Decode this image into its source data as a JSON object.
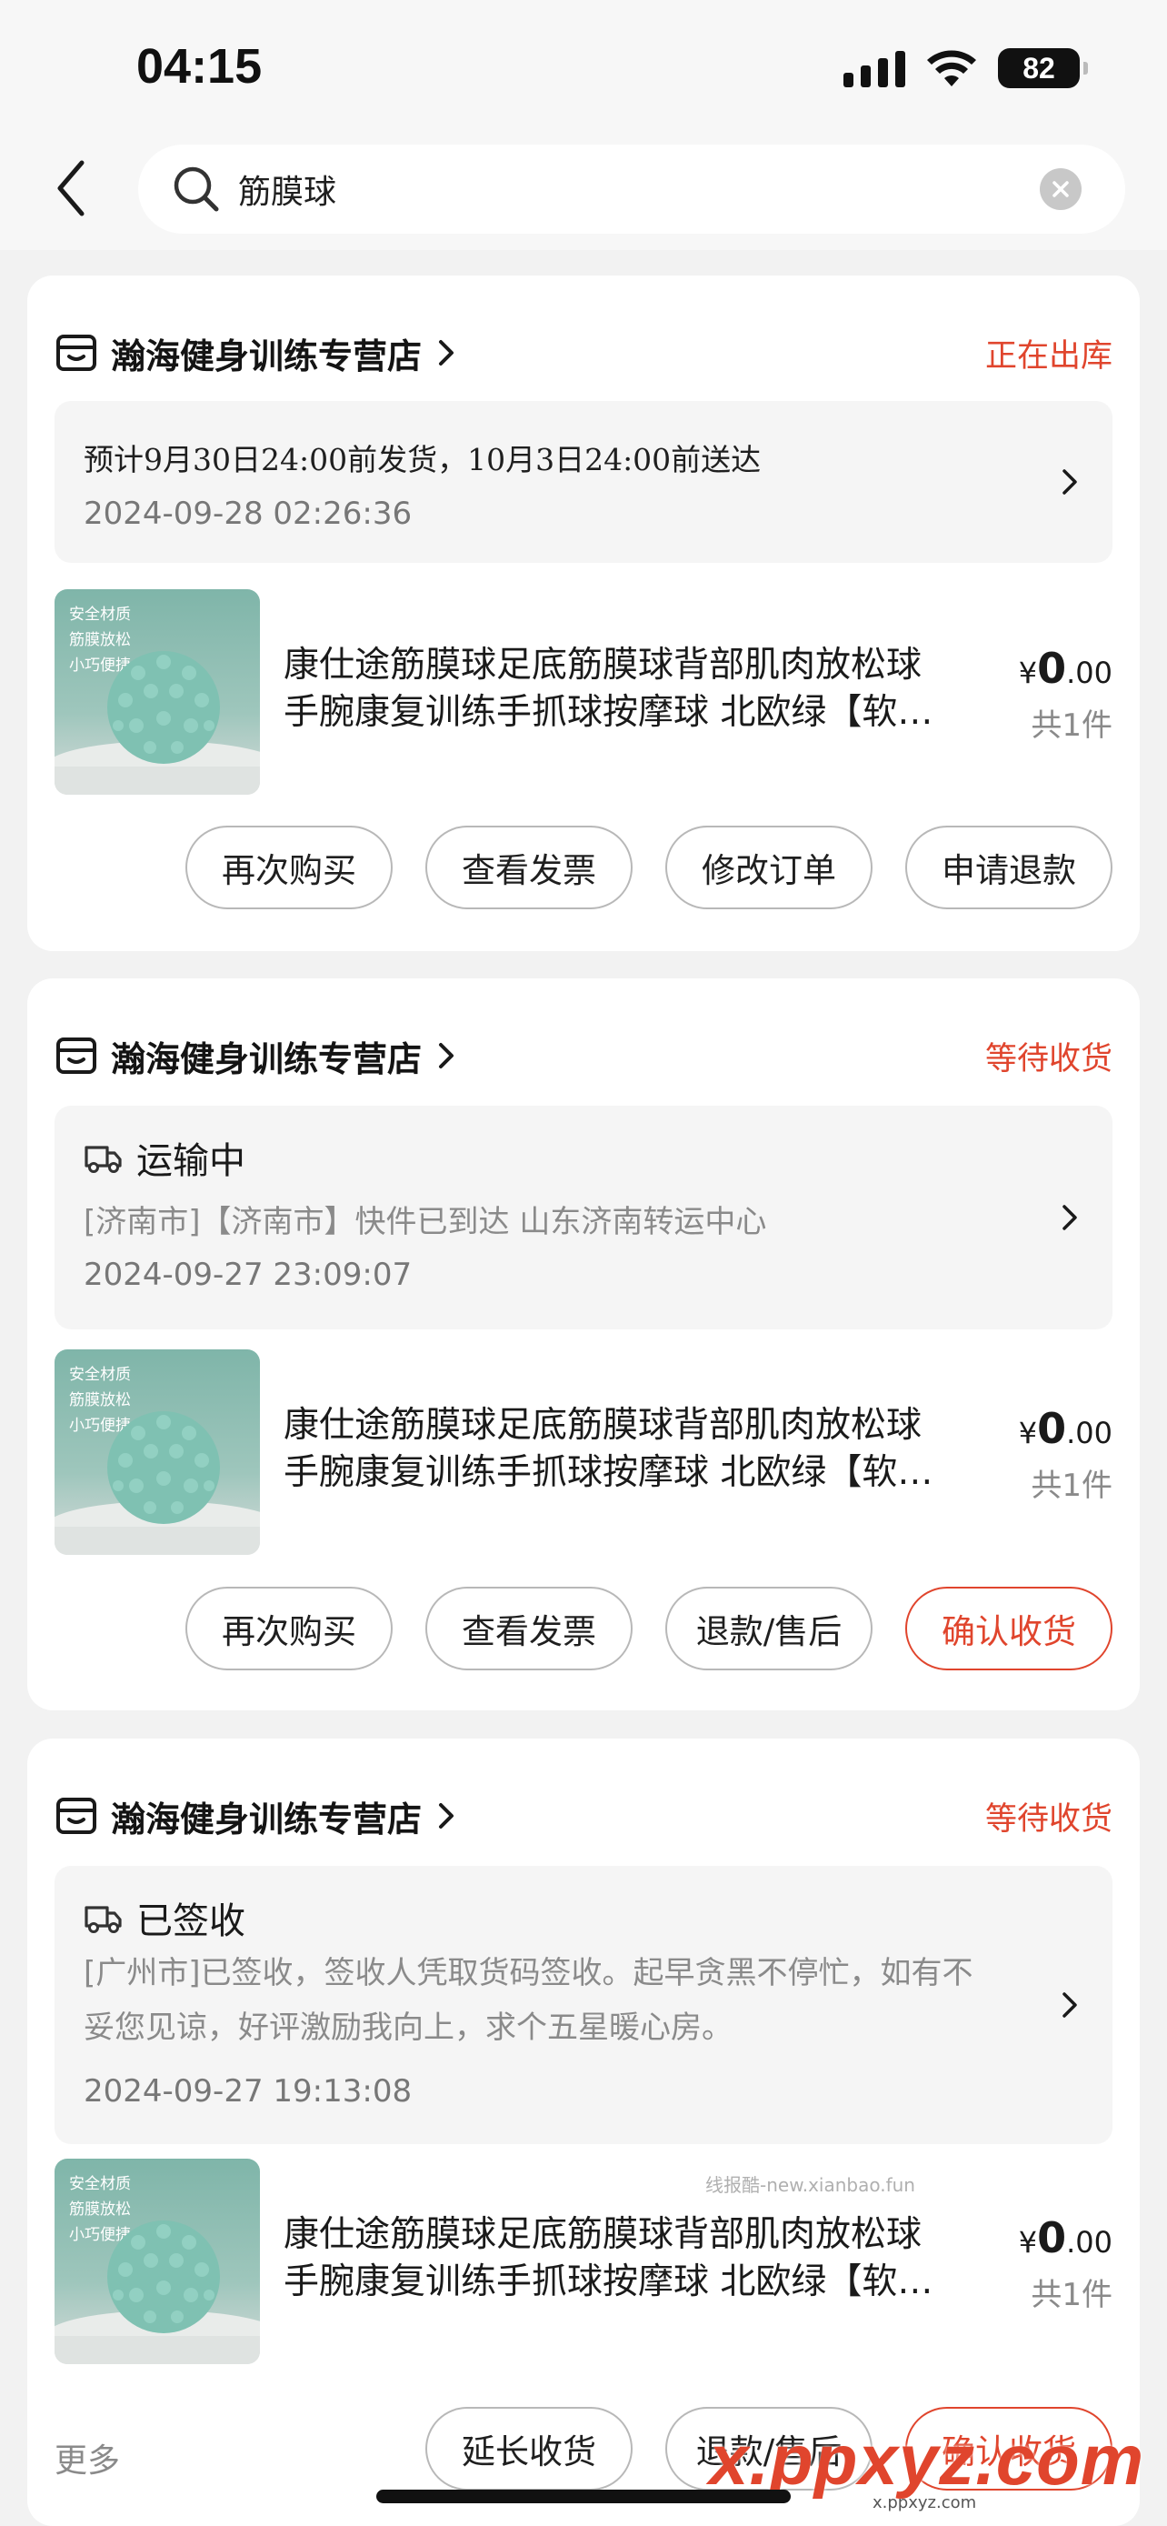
{
  "status_bar": {
    "time": "04:15",
    "battery": "82"
  },
  "search": {
    "query": "筋膜球"
  },
  "orders": [
    {
      "shop_name": "瀚海健身训练专营店",
      "status": "正在出库",
      "ship_plan": "预计9月30日24:00前发货，10月3日24:00前送达",
      "info_time": "2024-09-28 02:26:36",
      "product": {
        "image_tags": [
          "安全材质",
          "筋膜放松",
          "小巧便捷"
        ],
        "title_line1": "康仕途筋膜球足底筋膜球背部肌肉放松球",
        "title_line2": "手腕康复训练手抓球按摩球 北欧绿【软…",
        "price_symbol": "¥",
        "price_int": "0",
        "price_dec": ".00",
        "quantity": "共1件"
      },
      "buttons": [
        "再次购买",
        "查看发票",
        "修改订单",
        "申请退款"
      ]
    },
    {
      "shop_name": "瀚海健身训练专营店",
      "status": "等待收货",
      "logistics_title": "运输中",
      "logistics_detail": "[济南市]【济南市】快件已到达 山东济南转运中心",
      "info_time": "2024-09-27 23:09:07",
      "product": {
        "image_tags": [
          "安全材质",
          "筋膜放松",
          "小巧便捷"
        ],
        "title_line1": "康仕途筋膜球足底筋膜球背部肌肉放松球",
        "title_line2": "手腕康复训练手抓球按摩球 北欧绿【软…",
        "price_symbol": "¥",
        "price_int": "0",
        "price_dec": ".00",
        "quantity": "共1件"
      },
      "buttons": [
        "再次购买",
        "查看发票",
        "退款/售后",
        "确认收货"
      ]
    },
    {
      "shop_name": "瀚海健身训练专营店",
      "status": "等待收货",
      "logistics_title": "已签收",
      "logistics_detail_line1": "[广州市]已签收，签收人凭取货码签收。起早贪黑不停忙，如有不",
      "logistics_detail_line2": "妥您见谅，好评激励我向上，求个五星暖心房。",
      "info_time": "2024-09-27 19:13:08",
      "product": {
        "image_tags": [
          "安全材质",
          "筋膜放松",
          "小巧便捷"
        ],
        "title_line1": "康仕途筋膜球足底筋膜球背部肌肉放松球",
        "title_line2": "手腕康复训练手抓球按摩球 北欧绿【软…",
        "price_symbol": "¥",
        "price_int": "0",
        "price_dec": ".00",
        "quantity": "共1件"
      },
      "more_label": "更多",
      "buttons": [
        "延长收货",
        "退款/售后",
        "确认收货"
      ]
    }
  ],
  "watermarks": {
    "small": "线报酷-new.xianbao.fun",
    "big": "x.ppxyz.com",
    "sub": "x.ppxyz.com"
  },
  "colors": {
    "accent": "#e0452d",
    "background": "#f2f2f2"
  }
}
